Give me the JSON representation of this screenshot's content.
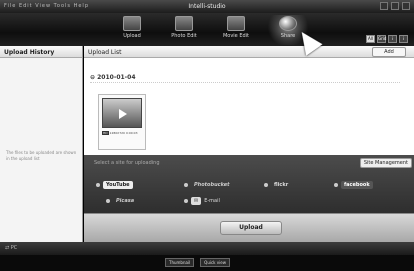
{
  "window": {
    "title": "Intelli-studio",
    "menu": "File  Edit  View  Tools  Help"
  },
  "toolbar": {
    "buttons": [
      {
        "label": "Upload"
      },
      {
        "label": "Photo Edit"
      },
      {
        "label": "Movie Edit"
      },
      {
        "label": "Share"
      }
    ],
    "view_buttons": [
      "All",
      "Grid",
      "i",
      "i"
    ]
  },
  "sidebar": {
    "title": "Upload History",
    "empty_message": "The files to be uploaded are shown in the upload list"
  },
  "upload_list": {
    "title": "Upload List",
    "add_button": "Add",
    "date": "2010-01-04",
    "items": [
      {
        "tag": "HD",
        "resolution": "1280X720",
        "duration": "0:00:03"
      }
    ]
  },
  "sites": {
    "title": "Select a site for uploading",
    "manage_button": "Site Management",
    "list": [
      {
        "name": "YouTube",
        "style": "yt"
      },
      {
        "name": "Photobucket",
        "style": "ph"
      },
      {
        "name": "flickr",
        "style": "fl"
      },
      {
        "name": "facebook",
        "style": "fb"
      },
      {
        "name": "Picasa",
        "style": "ph"
      },
      {
        "name": "E-mail",
        "style": "em"
      }
    ]
  },
  "upload_button": "Upload",
  "bottom": {
    "location": "PC",
    "buttons": [
      "Thumbnail",
      "Quick view"
    ]
  }
}
